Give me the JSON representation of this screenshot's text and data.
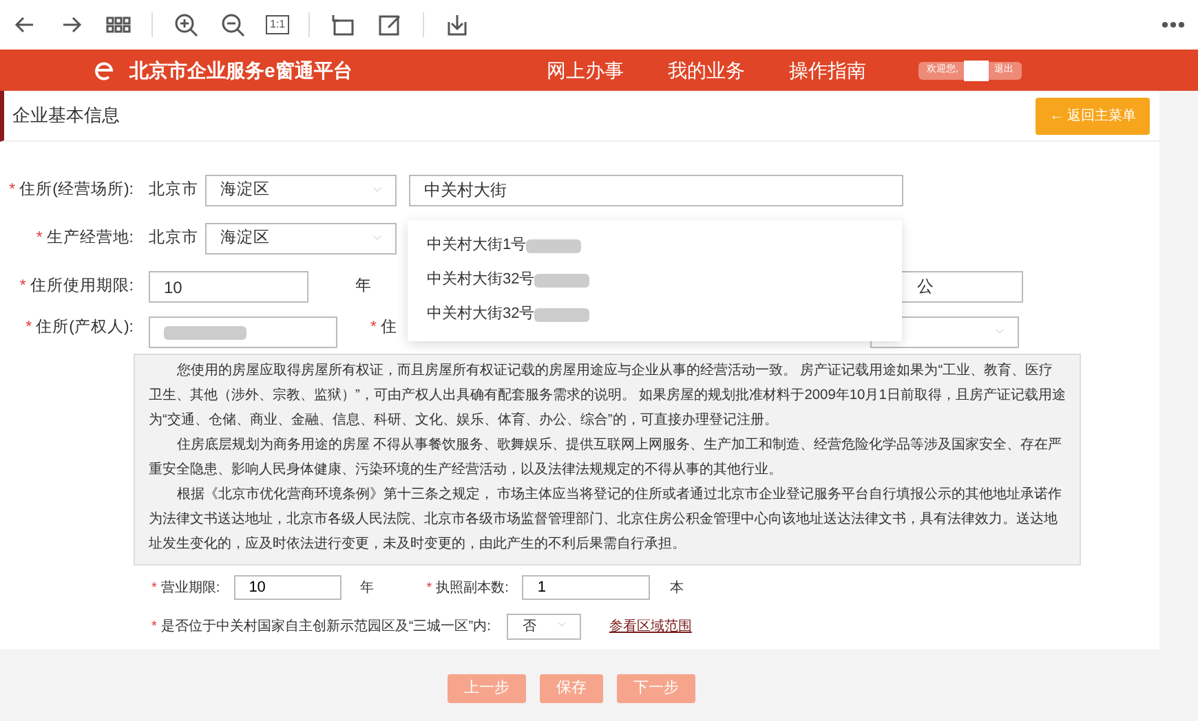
{
  "toolbar": {
    "actual_size_label": "1:1"
  },
  "header": {
    "site_title": "北京市企业服务e窗通平台",
    "nav": [
      "网上办事",
      "我的业务",
      "操作指南"
    ],
    "welcome": "欢迎您,",
    "logout": "退出"
  },
  "panel": {
    "title": "企业基本信息",
    "back_button": "← 返回主菜单"
  },
  "address_rows": [
    {
      "mark": "*",
      "label": "住所(经营场所):",
      "city": "北京市",
      "district": "海淀区",
      "street": "中关村大街"
    },
    {
      "mark": "*",
      "label": "生产经营地:",
      "city": "北京市",
      "district": "海淀区"
    }
  ],
  "term_row": {
    "mark": "*",
    "label": "住所使用期限:",
    "value": "10",
    "unit": "年",
    "extra_value": "公"
  },
  "owner_row": {
    "mark": "*",
    "label": "住所(产权人):",
    "second_mark": "*",
    "second_label": "住"
  },
  "suggestions": [
    "中关村大街1号",
    "中关村大街32号",
    "中关村大街32号"
  ],
  "notice": {
    "paragraphs": [
      "您使用的房屋应取得房屋所有权证，而且房屋所有权证记载的房屋用途应与企业从事的经营活动一致。 房产证记载用途如果为“工业、教育、医疗卫生、其他（涉外、宗教、监狱）”，可由产权人出具确有配套服务需求的说明。 如果房屋的规划批准材料于2009年10月1日前取得，且房产证记载用途为“交通、仓储、商业、金融、信息、科研、文化、娱乐、体育、办公、综合”的，可直接办理登记注册。",
      "住房底层规划为商务用途的房屋 不得从事餐饮服务、歌舞娱乐、提供互联网上网服务、生产加工和制造、经营危险化学品等涉及国家安全、存在严重安全隐患、影响人民身体健康、污染环境的生产经营活动，以及法律法规规定的不得从事的其他行业。",
      "根据《北京市优化营商环境条例》第十三条之规定， 市场主体应当将登记的住所或者通过北京市企业登记服务平台自行填报公示的其他地址承诺作为法律文书送达地址，北京市各级人民法院、北京市各级市场监督管理部门、北京住房公积金管理中心向该地址送达法律文书，具有法律效力。送达地址发生变化的，应及时依法进行变更，未及时变更的，由此产生的不利后果需自行承担。"
    ]
  },
  "business_term": {
    "mark": "*",
    "label": "营业期限:",
    "value": "10",
    "unit": "年"
  },
  "copies": {
    "mark": "*",
    "label": "执照副本数:",
    "value": "1",
    "unit": "本"
  },
  "zone": {
    "mark": "*",
    "label": "是否位于中关村国家自主创新示范园区及“三城一区”内:",
    "value": "否",
    "link": "参看区域范围"
  },
  "buttons": [
    "上一步",
    "保存",
    "下一步"
  ]
}
